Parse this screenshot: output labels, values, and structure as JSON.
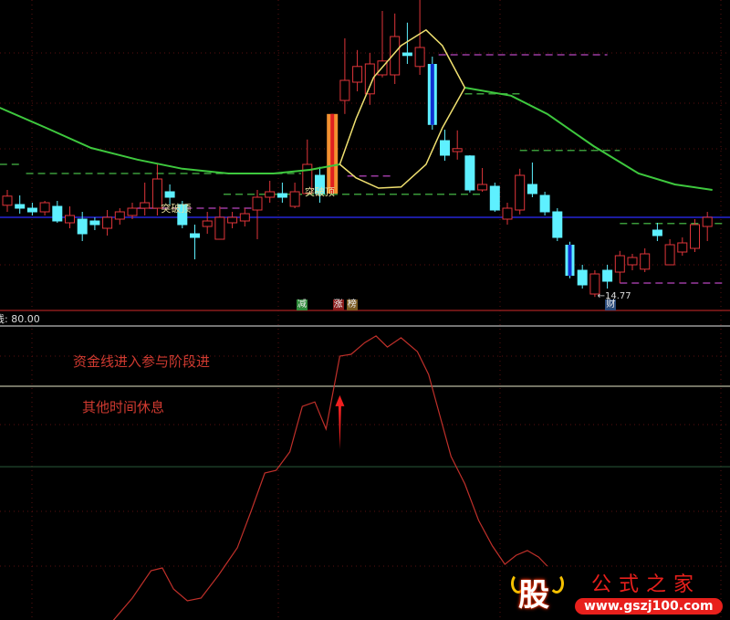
{
  "chart_data": {
    "type": "candlestick",
    "main_panel": {
      "candles_ohlc": [
        [
          17.28,
          17.7,
          17.1,
          17.53
        ],
        [
          17.3,
          17.55,
          17.05,
          17.2
        ],
        [
          17.2,
          17.35,
          17.0,
          17.1
        ],
        [
          17.1,
          17.4,
          17.0,
          17.35
        ],
        [
          17.25,
          17.4,
          16.8,
          16.85
        ],
        [
          16.8,
          17.25,
          16.65,
          17.0
        ],
        [
          16.9,
          17.1,
          16.3,
          16.5
        ],
        [
          16.85,
          16.95,
          16.6,
          16.75
        ],
        [
          16.65,
          17.15,
          16.45,
          16.95
        ],
        [
          16.9,
          17.2,
          16.75,
          17.1
        ],
        [
          17.0,
          17.35,
          16.9,
          17.2
        ],
        [
          17.2,
          17.9,
          17.0,
          17.35
        ],
        [
          17.2,
          18.4,
          17.0,
          18.0
        ],
        [
          17.65,
          17.85,
          17.3,
          17.5
        ],
        [
          17.3,
          17.4,
          16.65,
          16.75
        ],
        [
          16.5,
          16.75,
          15.8,
          16.4
        ],
        [
          16.7,
          17.1,
          16.5,
          16.85
        ],
        [
          16.35,
          17.25,
          16.35,
          16.95
        ],
        [
          16.8,
          17.1,
          16.65,
          16.95
        ],
        [
          16.85,
          17.2,
          16.7,
          17.05
        ],
        [
          17.15,
          17.7,
          16.35,
          17.5
        ],
        [
          17.5,
          17.95,
          17.35,
          17.65
        ],
        [
          17.6,
          17.9,
          17.35,
          17.5
        ],
        [
          17.25,
          17.9,
          17.2,
          17.65
        ],
        [
          17.6,
          19.08,
          17.6,
          18.4
        ],
        [
          18.1,
          18.33,
          17.35,
          17.6
        ],
        [
          17.6,
          19.78,
          17.6,
          19.78
        ],
        [
          20.15,
          21.85,
          19.78,
          20.7
        ],
        [
          20.65,
          21.53,
          20.4,
          21.08
        ],
        [
          20.33,
          21.45,
          20.03,
          21.15
        ],
        [
          20.85,
          22.6,
          20.78,
          21.23
        ],
        [
          20.85,
          22.53,
          20.6,
          21.9
        ],
        [
          21.45,
          22.28,
          21.15,
          21.38
        ],
        [
          21.08,
          22.9,
          20.85,
          21.6
        ],
        [
          21.15,
          21.35,
          19.35,
          19.48
        ],
        [
          19.05,
          19.35,
          18.5,
          18.65
        ],
        [
          18.75,
          19.33,
          18.53,
          18.83
        ],
        [
          18.63,
          18.65,
          17.63,
          17.7
        ],
        [
          17.7,
          18.3,
          17.65,
          17.85
        ],
        [
          17.8,
          17.9,
          17.1,
          17.15
        ],
        [
          16.9,
          17.35,
          16.75,
          17.2
        ],
        [
          17.15,
          18.28,
          17.03,
          18.1
        ],
        [
          17.85,
          18.45,
          17.5,
          17.6
        ],
        [
          17.55,
          17.65,
          17.0,
          17.1
        ],
        [
          17.1,
          17.2,
          16.3,
          16.4
        ],
        [
          16.2,
          16.28,
          15.28,
          15.35
        ],
        [
          15.5,
          15.65,
          15.0,
          15.1
        ],
        [
          14.85,
          15.5,
          14.77,
          15.4
        ],
        [
          15.5,
          15.65,
          15.0,
          15.2
        ],
        [
          15.45,
          16.03,
          15.15,
          15.9
        ],
        [
          15.65,
          15.95,
          15.5,
          15.85
        ],
        [
          15.53,
          16.1,
          15.45,
          15.95
        ],
        [
          16.6,
          16.8,
          16.3,
          16.45
        ],
        [
          15.65,
          16.35,
          15.65,
          16.2
        ],
        [
          16.0,
          16.4,
          15.9,
          16.25
        ],
        [
          16.1,
          16.9,
          16.0,
          16.75
        ],
        [
          16.7,
          17.1,
          16.3,
          16.95
        ]
      ],
      "highlight_bars": {
        "26": "signal-up",
        "34": "signal-down",
        "45": "signal-down"
      },
      "price_range": [
        14.4,
        22.9
      ],
      "ma_line": [
        [
          -0.6,
          19.95
        ],
        [
          3.1,
          19.4
        ],
        [
          6.7,
          18.85
        ],
        [
          10.4,
          18.53
        ],
        [
          14,
          18.28
        ],
        [
          17.7,
          18.15
        ],
        [
          21.3,
          18.15
        ],
        [
          24.2,
          18.25
        ],
        [
          26.6,
          18.4
        ],
        [
          36.6,
          20.5
        ],
        [
          40.3,
          20.28
        ],
        [
          43.2,
          19.78
        ],
        [
          46.9,
          18.9
        ],
        [
          50.5,
          18.15
        ],
        [
          53.4,
          17.85
        ],
        [
          56.4,
          17.7
        ]
      ],
      "band_upper": [
        [
          26.6,
          18.4
        ],
        [
          27.9,
          19.65
        ],
        [
          29.3,
          20.78
        ],
        [
          31.5,
          21.65
        ],
        [
          33.5,
          22.08
        ],
        [
          34.8,
          21.65
        ],
        [
          36.6,
          20.5
        ]
      ],
      "band_lower": [
        [
          26.6,
          18.4
        ],
        [
          27.9,
          18.03
        ],
        [
          29.7,
          17.75
        ],
        [
          31.5,
          17.78
        ],
        [
          33.5,
          18.4
        ],
        [
          34.8,
          19.4
        ],
        [
          36.6,
          20.5
        ]
      ],
      "base_line": 16.95,
      "levels": [
        {
          "price": 18.4,
          "from": -0.6,
          "to": 1.2,
          "kind": "support"
        },
        {
          "price": 18.15,
          "from": 1.5,
          "to": 23.5,
          "kind": "support"
        },
        {
          "price": 17.58,
          "from": 17.3,
          "to": 38,
          "kind": "support"
        },
        {
          "price": 17.2,
          "from": 10.4,
          "to": 19.8,
          "kind": "resistance"
        },
        {
          "price": 18.08,
          "from": 27.2,
          "to": 30.8,
          "kind": "resistance"
        },
        {
          "price": 21.4,
          "from": 34.5,
          "to": 48,
          "kind": "resistance"
        },
        {
          "price": 20.33,
          "from": 36.6,
          "to": 41,
          "kind": "support"
        },
        {
          "price": 18.78,
          "from": 41,
          "to": 49,
          "kind": "support"
        },
        {
          "price": 16.78,
          "from": 49,
          "to": 57.5,
          "kind": "support"
        },
        {
          "price": 15.15,
          "from": 49,
          "to": 57.5,
          "kind": "resistance"
        }
      ],
      "labels": [
        {
          "text": "突破顶",
          "index": 12,
          "price": 17.2
        },
        {
          "text": "突破顶",
          "index": 23.5,
          "price": 17.65
        }
      ],
      "low_marker": {
        "text": "←14.77",
        "index": 47.2,
        "price": 14.77
      },
      "badges": [
        {
          "text": "减",
          "index": 23.5,
          "color": "#2e8b3a"
        },
        {
          "text": "涨",
          "index": 26.4,
          "color": "#8a1c1c"
        },
        {
          "text": "榜",
          "index": 27.5,
          "color": "#7a5a20"
        },
        {
          "text": "财",
          "index": 48.2,
          "color": "#2a4a7a"
        }
      ]
    },
    "sub_panel": {
      "header": "线: 80.00",
      "value_range": [
        0,
        105
      ],
      "ref_lines": [
        100,
        80,
        53.3
      ],
      "capital_line": [
        [
          8.5,
          2.4
        ],
        [
          10,
          9.7
        ],
        [
          11.5,
          18.8
        ],
        [
          12.4,
          19.7
        ],
        [
          13.3,
          12.7
        ],
        [
          14.4,
          8.8
        ],
        [
          15.5,
          9.7
        ],
        [
          16.9,
          17.3
        ],
        [
          18.4,
          26.4
        ],
        [
          19.5,
          38.5
        ],
        [
          20.6,
          51.2
        ],
        [
          21.5,
          52.1
        ],
        [
          22.6,
          58.2
        ],
        [
          23.6,
          73.3
        ],
        [
          24.6,
          74.8
        ],
        [
          25.5,
          65.8
        ],
        [
          26.6,
          90
        ],
        [
          27.5,
          90.6
        ],
        [
          28.6,
          94.5
        ],
        [
          29.5,
          96.7
        ],
        [
          30.4,
          93
        ],
        [
          31.5,
          96.1
        ],
        [
          32.8,
          91.5
        ],
        [
          33.7,
          83.9
        ],
        [
          34.6,
          70.3
        ],
        [
          35.5,
          56.7
        ],
        [
          36.6,
          47.6
        ],
        [
          37.7,
          35.5
        ],
        [
          38.8,
          27
        ],
        [
          39.8,
          20.9
        ],
        [
          40.7,
          23.9
        ],
        [
          41.6,
          25.5
        ],
        [
          42.5,
          23.3
        ],
        [
          43.2,
          20.3
        ]
      ],
      "arrow": {
        "index": 26.6,
        "from": 59,
        "to": 77
      },
      "annotations": [
        "资金线进入参与阶段进",
        "其他时间休息"
      ]
    },
    "colors": {
      "up": "#e0353a",
      "down": "#5ef0ff",
      "ma": "#3ec83e",
      "band": "#f0e070",
      "base": "#1c1ca0",
      "capital": "#c0302a"
    }
  },
  "watermark": {
    "icon_char": "股",
    "name": "公式之家",
    "url": "www.gszj100.com"
  }
}
